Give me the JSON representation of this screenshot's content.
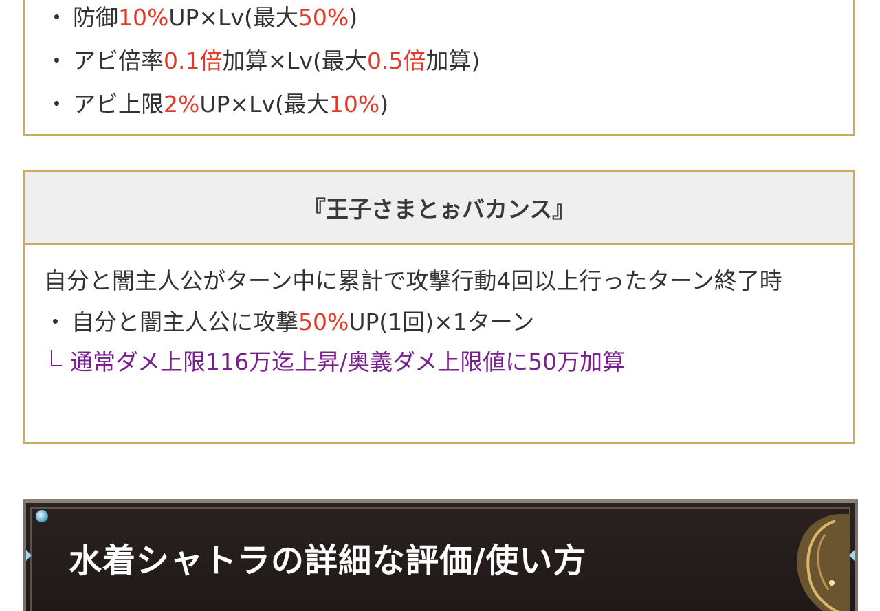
{
  "top_box": {
    "line1": {
      "bullet": "・",
      "a": "防御",
      "b": "10%",
      "c": "UP×Lv(最大",
      "d": "50%",
      "e": ")"
    },
    "line2": {
      "bullet": "・",
      "a": "アビ倍率",
      "b": "0.1倍",
      "c": "加算×Lv(最大",
      "d": "0.5倍",
      "e": "加算)"
    },
    "line3": {
      "bullet": "・",
      "a": "アビ上限",
      "b": "2%",
      "c": "UP×Lv(最大",
      "d": "10%",
      "e": ")"
    }
  },
  "skill": {
    "title": "『王子さまとぉバカンス』",
    "desc": "自分と闇主人公がターン中に累計で攻撃行動4回以上行ったターン終了時",
    "effect": {
      "bullet": "・",
      "a": "自分と闇主人公に攻撃",
      "b": "50%",
      "c": "UP(1回)×1ターン"
    },
    "note": "通常ダメ上限116万迄上昇/奥義ダメ上限値に50万加算"
  },
  "banner": {
    "title": "水着シャトラの詳細な評価/使い方"
  },
  "colors": {
    "accent_red": "#e23a2a",
    "note_purple": "#7a1f8f",
    "border_gold": "#c9ad5c"
  }
}
